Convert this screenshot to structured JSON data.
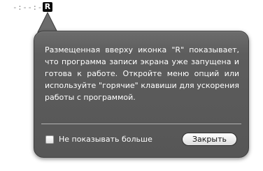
{
  "menubar": {
    "timer_text": "-:--:--",
    "app_icon_letter": "R",
    "app_icon": "recorder-r-icon"
  },
  "popover": {
    "message": "Размещенная вверху иконка \"R\" показывает, что программа записи экрана уже запущена и готова к работе. Откройте меню опций или используйте \"горячие\" клавиши для ускорения работы с программой.",
    "checkbox_label": "Не показывать больше",
    "checkbox_checked": false,
    "close_label": "Закрыть",
    "background_color": "#5b5b5b",
    "text_color": "#ffffff"
  }
}
